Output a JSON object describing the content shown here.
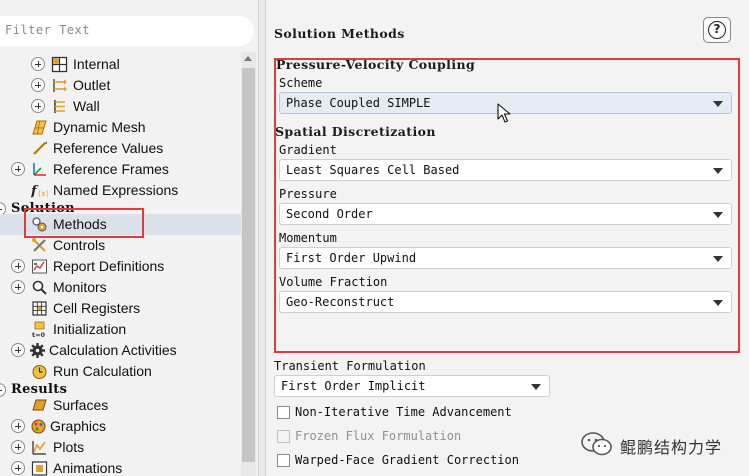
{
  "filter": {
    "placeholder": "Filter Text"
  },
  "tree": {
    "internal": "Internal",
    "outlet": "Outlet",
    "wall": "Wall",
    "dynamic_mesh": "Dynamic Mesh",
    "reference_values": "Reference Values",
    "reference_frames": "Reference Frames",
    "named_expressions": "Named Expressions",
    "solution_header": "Solution",
    "methods": "Methods",
    "controls": "Controls",
    "report_definitions": "Report Definitions",
    "monitors": "Monitors",
    "cell_registers": "Cell Registers",
    "initialization": "Initialization",
    "calculation_activities": "Calculation Activities",
    "run_calculation": "Run Calculation",
    "results_header": "Results",
    "surfaces": "Surfaces",
    "graphics": "Graphics",
    "plots": "Plots",
    "animations": "Animations"
  },
  "panel": {
    "title": "Solution Methods",
    "help_glyph": "?",
    "pv_coupling": {
      "title": "Pressure-Velocity Coupling",
      "scheme_label": "Scheme",
      "scheme_value": "Phase Coupled SIMPLE"
    },
    "spatial": {
      "title": "Spatial Discretization",
      "gradient_label": "Gradient",
      "gradient_value": "Least Squares Cell Based",
      "pressure_label": "Pressure",
      "pressure_value": "Second Order",
      "momentum_label": "Momentum",
      "momentum_value": "First Order Upwind",
      "volume_fraction_label": "Volume Fraction",
      "volume_fraction_value": "Geo-Reconstruct"
    },
    "transient": {
      "label": "Transient Formulation",
      "value": "First Order Implicit"
    },
    "options": {
      "non_iterative": "Non-Iterative Time Advancement",
      "frozen_flux": "Frozen Flux Formulation",
      "warped_face": "Warped-Face Gradient Correction"
    }
  },
  "watermark": {
    "text": "鲲鹏结构力学"
  },
  "colors": {
    "highlight_red": "#e23b3b",
    "selected_row": "#dbe1ea",
    "panel_bg": "#f3f3f3"
  }
}
